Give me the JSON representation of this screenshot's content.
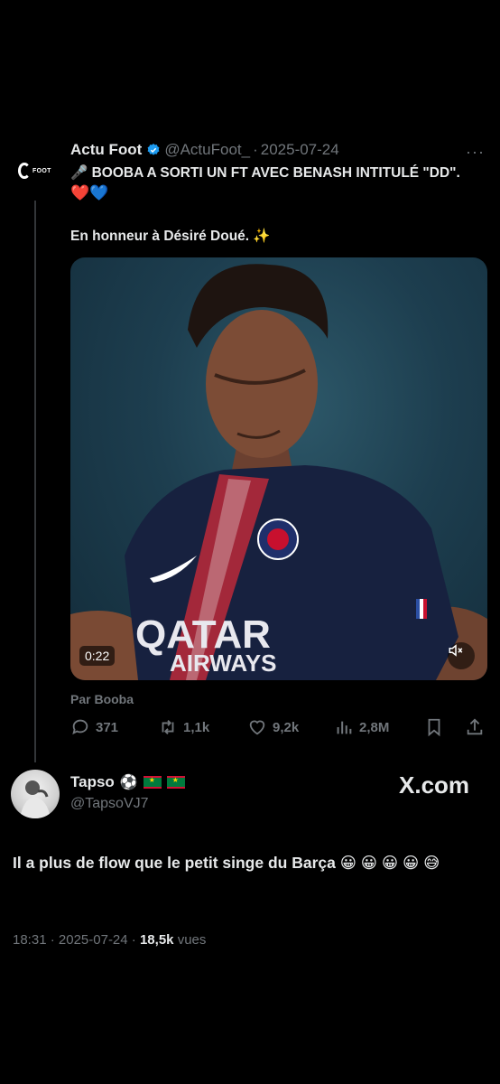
{
  "quoted_tweet": {
    "author_name": "Actu Foot",
    "handle": "@ActuFoot_",
    "separator": "·",
    "date": "2025-07-24",
    "more_label": "···",
    "avatar_text": "FOOT",
    "text_line1": "🎤 BOOBA A SORTI UN FT AVEC BENASH INTITULÉ \"DD\".",
    "text_line2": "❤️💙",
    "text_line3": "En honneur à Désiré Doué. ✨",
    "media": {
      "duration": "0:22",
      "shirt_text_1": "QATAR",
      "shirt_text_2": "AIRWAYS"
    },
    "source_label": "Par Booba",
    "actions": {
      "replies": "371",
      "reposts": "1,1k",
      "likes": "9,2k",
      "views": "2,8M"
    }
  },
  "reply_tweet": {
    "author_name": "Tapso",
    "name_emoji": "⚽",
    "handle": "@TapsoVJ7",
    "watermark": "X.com",
    "text": "Il a plus de flow que le petit singe du Barça 😀 😀 😀 😀 😅",
    "time": "18:31",
    "date": "2025-07-24",
    "views": "18,5k",
    "views_label": "vues"
  },
  "colors": {
    "background": "#000000",
    "text": "#e7e9ea",
    "muted": "#71767b",
    "verified": "#1d9bf0"
  }
}
